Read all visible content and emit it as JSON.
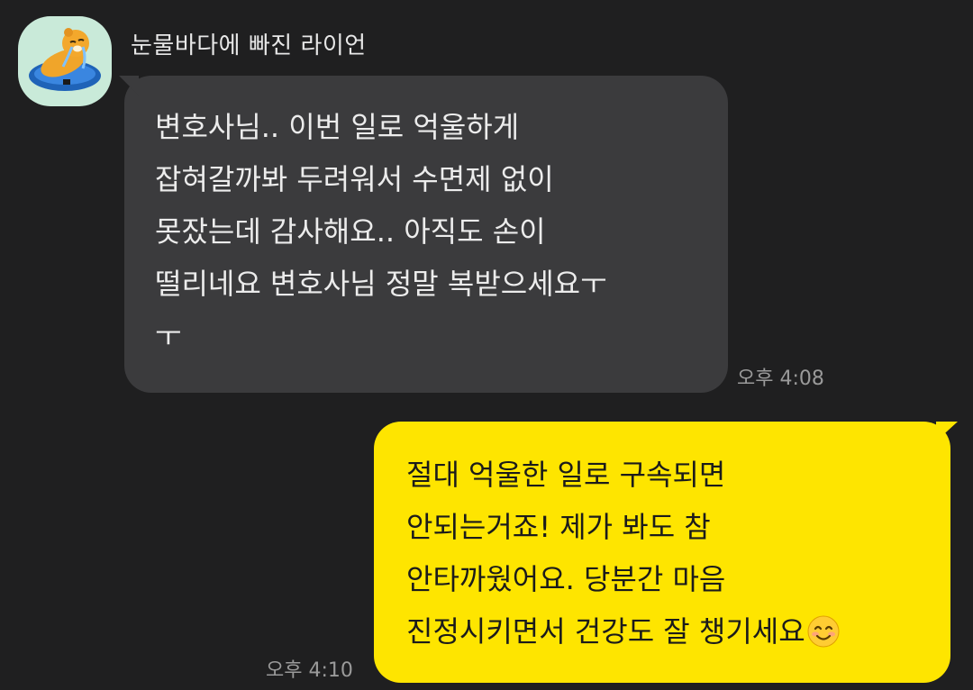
{
  "chat": {
    "sender": {
      "name": "눈물바다에 빠진 라이언",
      "avatar_icon": "crying-lion-avatar-icon"
    },
    "messages": [
      {
        "direction": "incoming",
        "lines": [
          "변호사님.. 이번 일로 억울하게",
          "잡혀갈까봐 두려워서 수면제 없이",
          "못잤는데 감사해요.. 아직도 손이",
          "떨리네요 변호사님 정말 복받으세요ㅜ",
          "ㅜ"
        ],
        "time": "오후 4:08"
      },
      {
        "direction": "outgoing",
        "lines": [
          "절대 억울한 일로 구속되면",
          "안되는거죠! 제가 봐도 참",
          "안타까웠어요. 당분간 마음",
          "진정시키면서 건강도 잘 챙기세요"
        ],
        "trailing_emoji": "smiling-face-icon",
        "time": "오후 4:10"
      }
    ],
    "colors": {
      "background": "#1f1f20",
      "incoming_bubble": "#3b3b3d",
      "outgoing_bubble": "#fee500",
      "avatar_bg": "#c9ead9"
    }
  }
}
